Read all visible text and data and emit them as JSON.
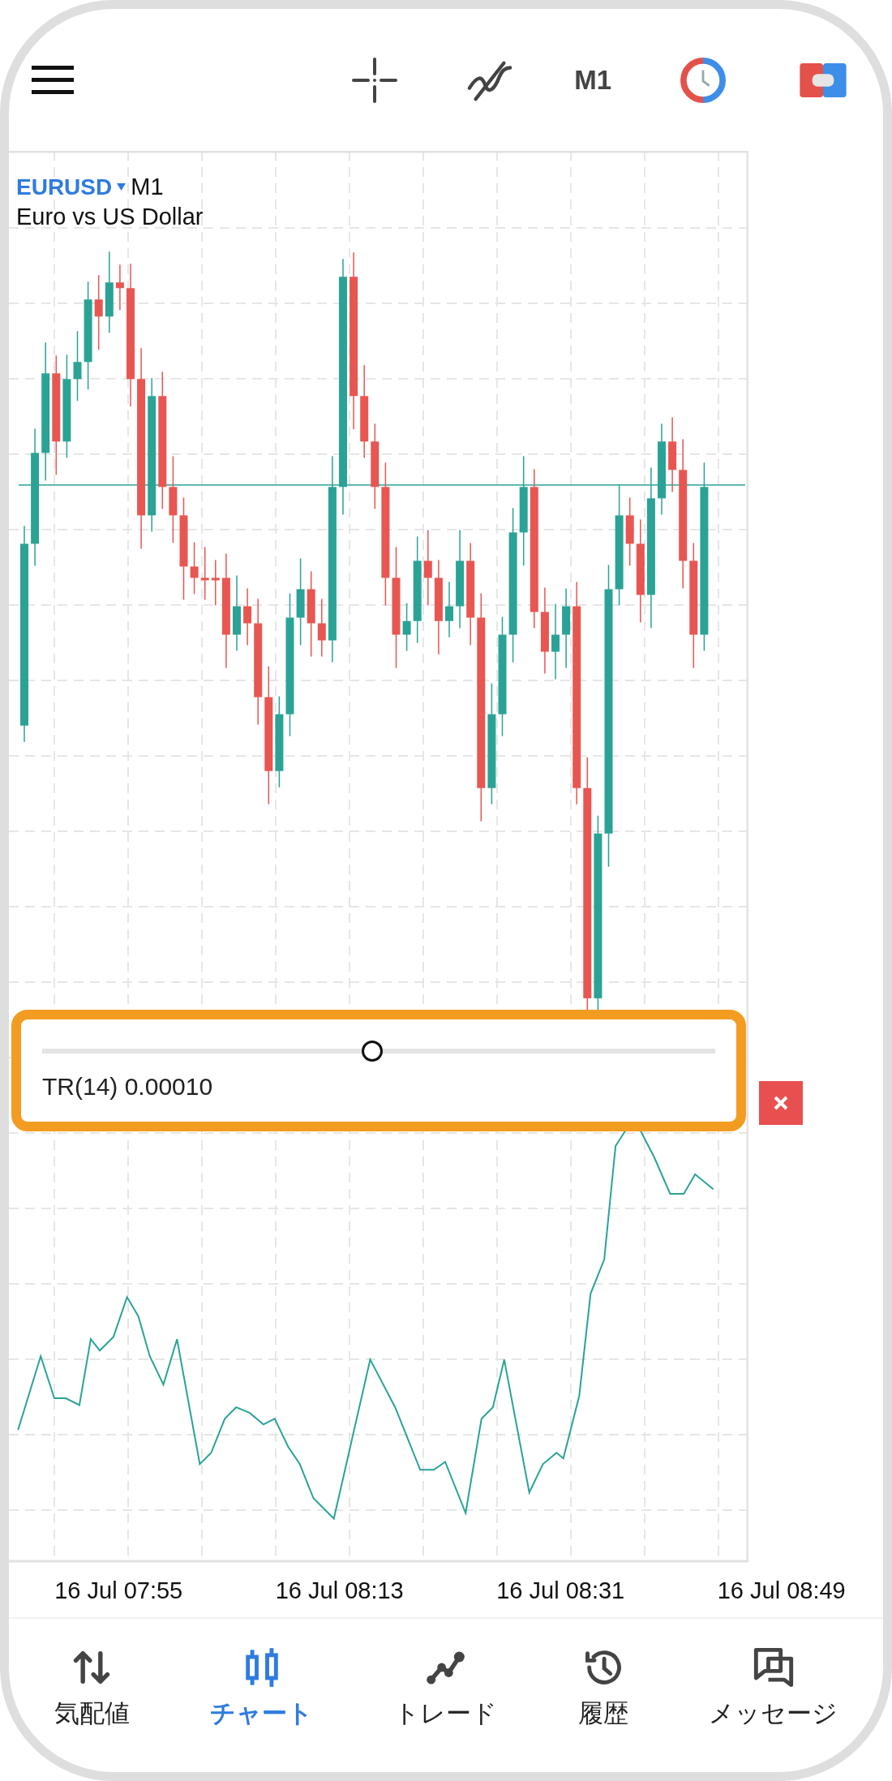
{
  "toolbar": {
    "timeframe": "M1"
  },
  "chart": {
    "symbol": "EURUSD",
    "timeframe": "M1",
    "description": "Euro vs US Dollar",
    "x_labels": [
      "16 Jul 07:55",
      "16 Jul 08:13",
      "16 Jul 08:31",
      "16 Jul 08:49"
    ]
  },
  "indicator": {
    "label": "TR(14) 0.00010",
    "level": 0.49
  },
  "nav": [
    {
      "label": "気配値",
      "kind": "quotes",
      "selected": false
    },
    {
      "label": "チャート",
      "kind": "chart",
      "selected": true
    },
    {
      "label": "トレード",
      "kind": "trade",
      "selected": false
    },
    {
      "label": "履歴",
      "kind": "history",
      "selected": false
    },
    {
      "label": "メッセージ",
      "kind": "messages",
      "selected": false
    }
  ]
}
